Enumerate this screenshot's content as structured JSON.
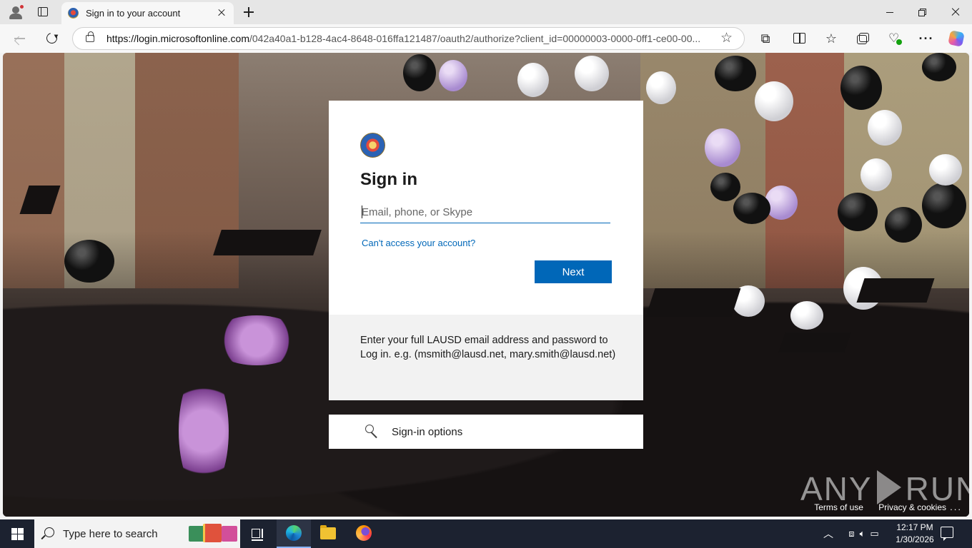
{
  "browser": {
    "tab_title": "Sign in to your account",
    "url_host": "https://login.microsoftonline.com",
    "url_rest": "/042a40a1-b128-4ac4-8648-016ffa121487/oauth2/authorize?client_id=00000003-0000-0ff1-ce00-00...",
    "icons": {
      "profile": "profile-icon",
      "tab_actions": "tab-actions-icon",
      "new_tab": "plus-icon",
      "back": "back-arrow-icon",
      "refresh": "refresh-icon",
      "lock": "lock-icon",
      "favorite_star": "star-outline-icon",
      "extensions": "puzzle-icon",
      "split_screen": "split-screen-icon",
      "favorites": "favorites-star-icon",
      "collections": "collections-icon",
      "performance": "browser-essentials-icon",
      "more": "ellipsis-icon",
      "copilot": "copilot-icon"
    }
  },
  "signin": {
    "title": "Sign in",
    "email_placeholder": "Email, phone, or Skype",
    "email_value": "",
    "cant_access": "Can't access your account?",
    "next_label": "Next",
    "hint": "Enter your full LAUSD email address and password to Log in. e.g. (msmith@lausd.net, mary.smith@lausd.net)",
    "options_label": "Sign-in options",
    "accent_color": "#0067b8"
  },
  "footer": {
    "terms": "Terms of use",
    "privacy": "Privacy & cookies",
    "more": "..."
  },
  "watermark": {
    "left": "ANY",
    "right": "RUN"
  },
  "taskbar": {
    "search_placeholder": "Type here to search",
    "time": "12:17 PM",
    "date": "1/30/2026",
    "apps": [
      "task-view-icon",
      "edge-icon",
      "file-explorer-icon",
      "firefox-icon"
    ]
  }
}
